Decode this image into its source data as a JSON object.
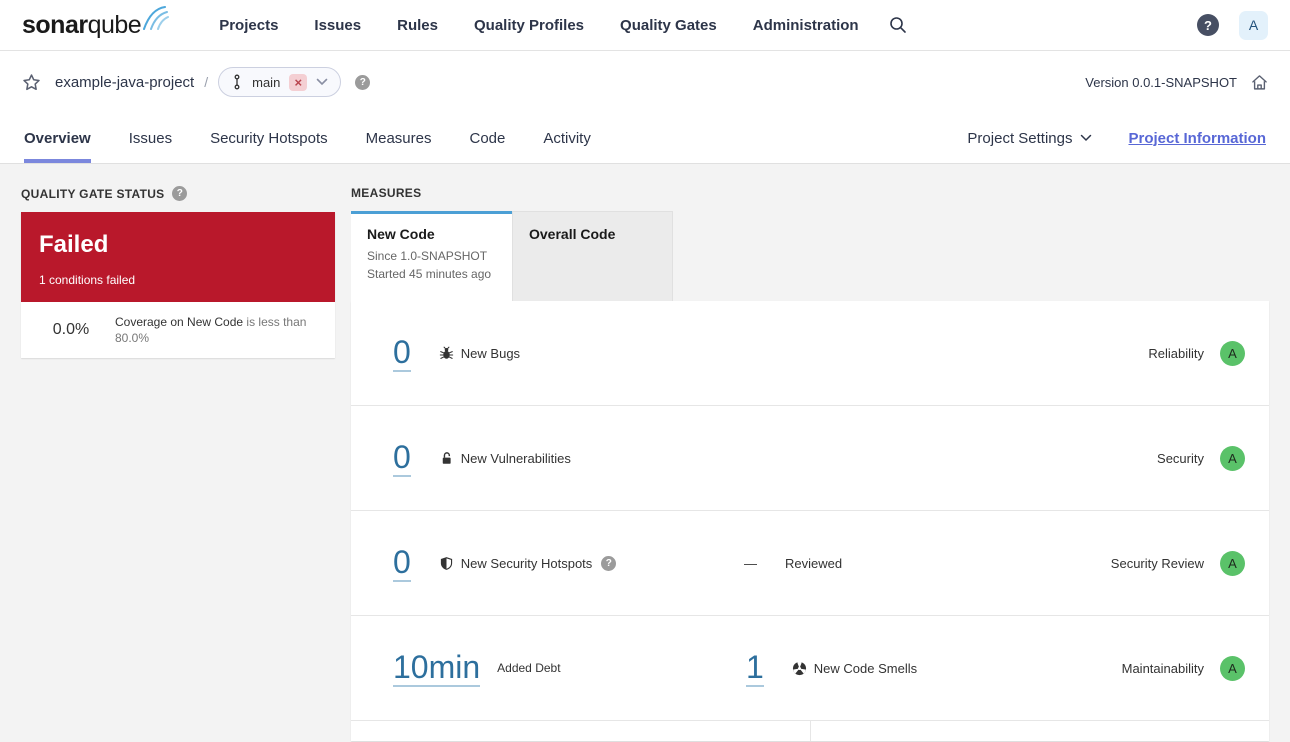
{
  "colors": {
    "quality_gate_failed_red": "#b9182b",
    "rating_a_green": "#5ac269",
    "link_blue": "#2d6f9d",
    "active_tab_blue": "#4b9fd5",
    "accent_purple": "#5867d6",
    "page_background": "#f3f3f3"
  },
  "icons": {
    "question": "?",
    "close": "×"
  },
  "navbar": {
    "logo_bold": "sonar",
    "logo_light": "qube",
    "items": [
      {
        "label": "Projects"
      },
      {
        "label": "Issues"
      },
      {
        "label": "Rules"
      },
      {
        "label": "Quality Profiles"
      },
      {
        "label": "Quality Gates"
      },
      {
        "label": "Administration"
      }
    ],
    "avatar_letter": "A"
  },
  "breadcrumb": {
    "project_name": "example-java-project",
    "separator": "/",
    "branch_name": "main",
    "version_label": "Version 0.0.1-SNAPSHOT"
  },
  "tabs": {
    "items": [
      {
        "label": "Overview"
      },
      {
        "label": "Issues"
      },
      {
        "label": "Security Hotspots"
      },
      {
        "label": "Measures"
      },
      {
        "label": "Code"
      },
      {
        "label": "Activity"
      }
    ],
    "project_settings_label": "Project Settings",
    "project_information_label": "Project Information"
  },
  "quality_gate": {
    "section_title": "QUALITY GATE STATUS",
    "status": "Failed",
    "conditions_summary": "1 conditions failed",
    "condition": {
      "value": "0.0%",
      "metric": "Coverage on New Code",
      "criteria": "is less than 80.0%"
    }
  },
  "measures": {
    "section_title": "MEASURES",
    "new_code_tab": {
      "label": "New Code",
      "since": "Since 1.0-SNAPSHOT",
      "started": "Started 45 minutes ago"
    },
    "overall_code_tab": {
      "label": "Overall Code"
    },
    "rows": [
      {
        "value": "0",
        "label": "New Bugs",
        "domain": "Reliability",
        "rating": "A"
      },
      {
        "value": "0",
        "label": "New Vulnerabilities",
        "domain": "Security",
        "rating": "A"
      },
      {
        "value": "0",
        "label": "New Security Hotspots",
        "reviewed_value": "—",
        "reviewed_label": "Reviewed",
        "domain": "Security Review",
        "rating": "A"
      },
      {
        "value": "10min",
        "label": "Added Debt",
        "secondary_value": "1",
        "secondary_label": "New Code Smells",
        "domain": "Maintainability",
        "rating": "A"
      }
    ]
  }
}
